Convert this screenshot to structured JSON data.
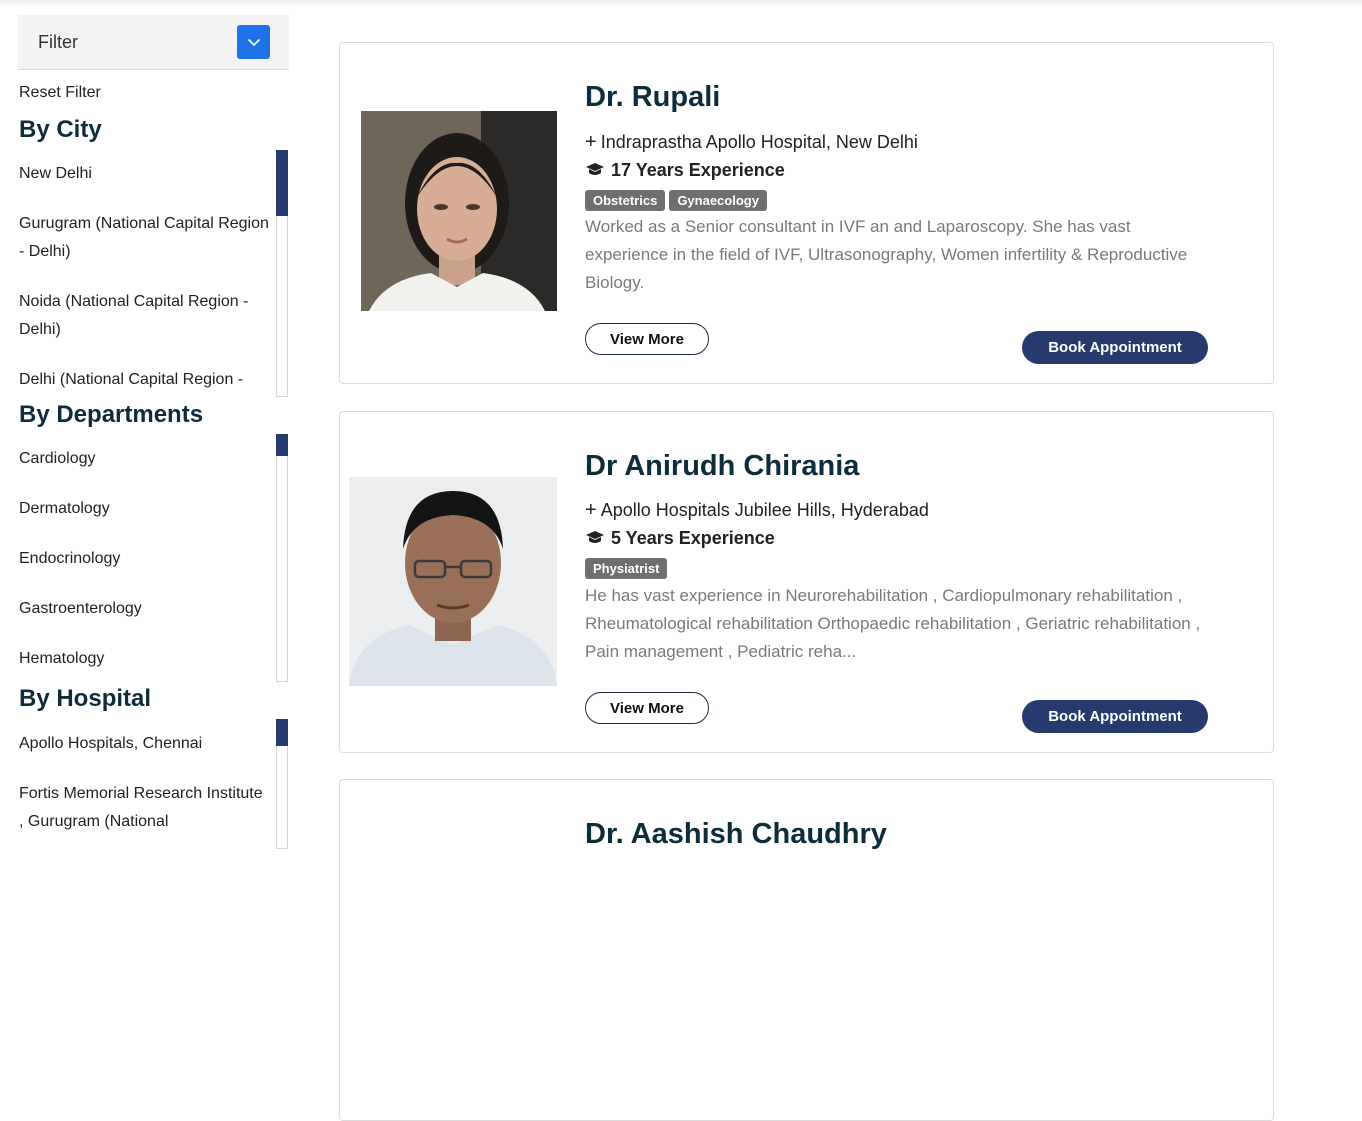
{
  "filter": {
    "label": "Filter",
    "reset_label": "Reset Filter"
  },
  "sections": {
    "city": {
      "title": "By City",
      "items": [
        "New Delhi",
        "Gurugram (National Capital Region - Delhi)",
        "Noida (National Capital Region - Delhi)",
        "Delhi (National Capital Region -"
      ]
    },
    "departments": {
      "title": "By Departments",
      "items": [
        "Cardiology",
        "Dermatology",
        "Endocrinology",
        "Gastroenterology",
        "Hematology"
      ]
    },
    "hospital": {
      "title": "By Hospital",
      "items": [
        "Apollo Hospitals, Chennai",
        "Fortis Memorial Research Institute , Gurugram (National"
      ]
    }
  },
  "doctors": [
    {
      "name": "Dr. Rupali",
      "hospital": "Indraprastha Apollo Hospital, New Delhi",
      "experience": "17 Years Experience",
      "tags": [
        "Obstetrics",
        "Gynaecology"
      ],
      "description": "Worked as a Senior consultant in IVF an and Laparoscopy. She has vast experience in the field of IVF, Ultrasonography, Women infertility & Reproductive Biology.",
      "view_more": "View More",
      "book": "Book Appointment"
    },
    {
      "name": "Dr Anirudh Chirania",
      "hospital": "Apollo Hospitals Jubilee Hills, Hyderabad",
      "experience": "5 Years Experience",
      "tags": [
        "Physiatrist"
      ],
      "description": "He has vast experience in Neurorehabilitation , Cardiopulmonary rehabilitation , Rheumatological rehabilitation Orthopaedic rehabilitation , Geriatric rehabilitation , Pain management , Pediatric reha...",
      "view_more": "View More",
      "book": "Book Appointment"
    },
    {
      "name": "Dr. Aashish Chaudhry"
    }
  ],
  "icons": {
    "filter_toggle": "chevron-down-icon",
    "hospital": "plus-icon",
    "experience": "graduation-cap-icon"
  },
  "colors": {
    "accent_navy": "#263a6e",
    "filter_blue": "#1e73e8",
    "heading": "#0f2c3a",
    "tag_gray": "#6f6f72"
  }
}
